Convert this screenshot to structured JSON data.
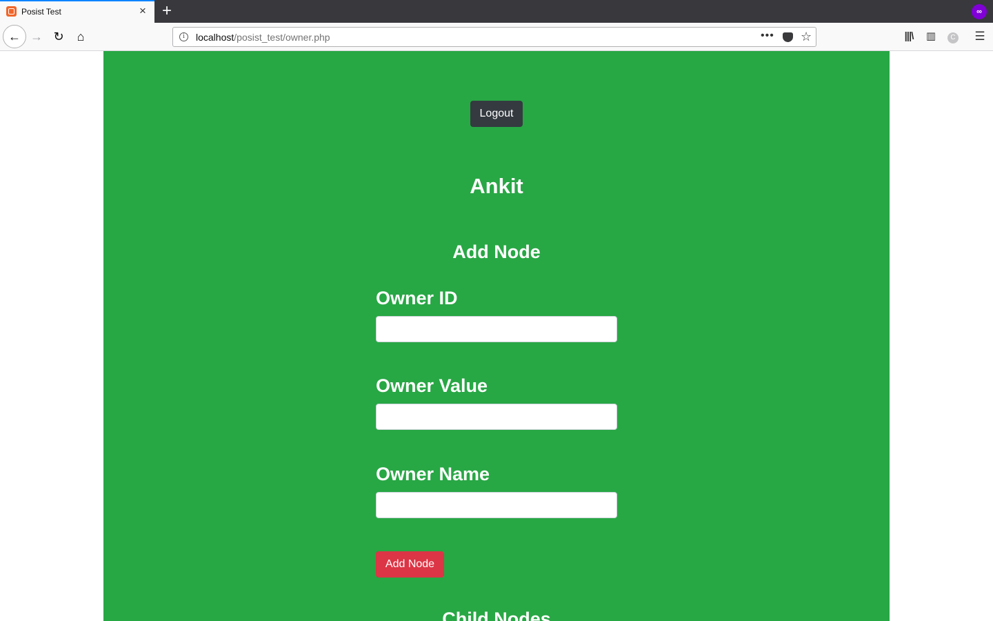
{
  "browser": {
    "tab_title": "Posist Test",
    "tab_close": "×",
    "new_tab": "+",
    "url_host": "localhost",
    "url_path": "/posist_test/owner.php",
    "url_more": "•••",
    "star": "☆",
    "back": "←",
    "forward": "→",
    "reload": "↻",
    "home": "⌂",
    "menu": "☰"
  },
  "page": {
    "logout_label": "Logout",
    "user_name": "Ankit",
    "form_title": "Add Node",
    "fields": [
      {
        "label": "Owner ID",
        "value": ""
      },
      {
        "label": "Owner Value",
        "value": ""
      },
      {
        "label": "Owner Name",
        "value": ""
      }
    ],
    "submit_label": "Add Node",
    "child_nodes_title": "Child Nodes",
    "background_color": "#28a745",
    "logout_color": "#343a40",
    "submit_color": "#dc3545"
  }
}
